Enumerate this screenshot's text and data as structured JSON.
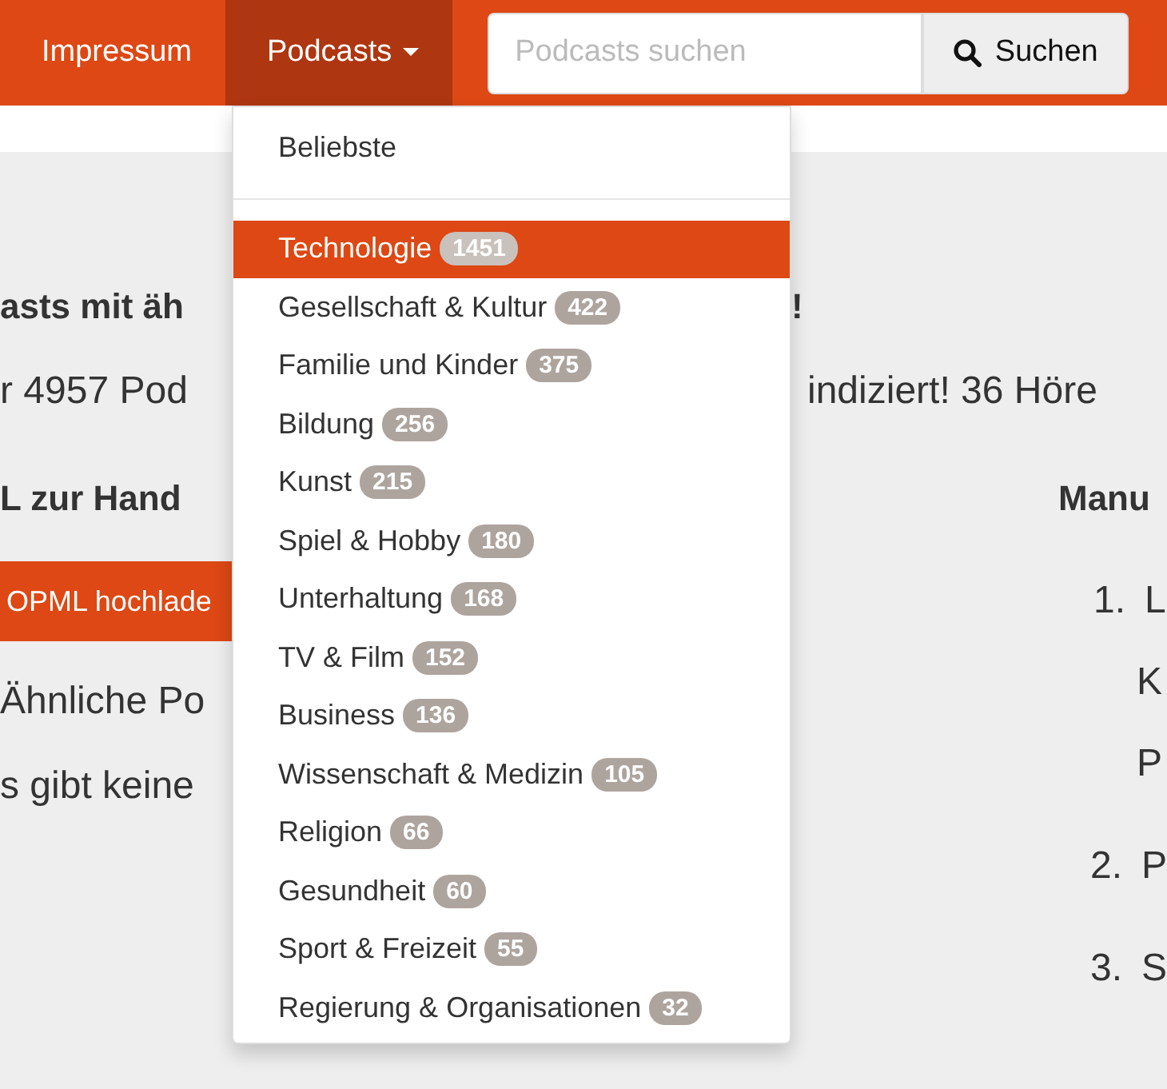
{
  "nav": {
    "items": [
      {
        "label": "Impressum",
        "selected": false,
        "kind": "link"
      },
      {
        "label": "Podcasts",
        "selected": true,
        "kind": "dropdown"
      }
    ],
    "search": {
      "placeholder": "Podcasts suchen",
      "button": "Suchen"
    }
  },
  "page": {
    "left": [
      {
        "kind": "heading",
        "text": "asts mit äh"
      },
      {
        "kind": "text",
        "text": "r 4957 Pod"
      },
      {
        "kind": "subheading",
        "text": "L zur Hand"
      },
      {
        "kind": "button",
        "text": "OPML hochlade"
      },
      {
        "kind": "text",
        "text": "Ähnliche Po"
      },
      {
        "kind": "text",
        "text": "s gibt keine"
      }
    ],
    "right": [
      {
        "kind": "heading",
        "text": "!"
      },
      {
        "kind": "text",
        "text": "indiziert! 36 Höre"
      },
      {
        "kind": "subheading",
        "text": "Manu"
      },
      {
        "kind": "list-item",
        "number": "1.",
        "text": "L"
      },
      {
        "kind": "note",
        "text": "K"
      },
      {
        "kind": "note",
        "text": "P"
      },
      {
        "kind": "list-item",
        "number": "2.",
        "text": "P"
      },
      {
        "kind": "list-item",
        "number": "3.",
        "text": "S"
      }
    ]
  },
  "dropdown": {
    "header": "Beliebste",
    "categories": [
      {
        "name": "Technologie",
        "count": "1451",
        "selected": true
      },
      {
        "name": "Gesellschaft & Kultur",
        "count": "422",
        "selected": false
      },
      {
        "name": "Familie und Kinder",
        "count": "375",
        "selected": false
      },
      {
        "name": "Bildung",
        "count": "256",
        "selected": false
      },
      {
        "name": "Kunst",
        "count": "215",
        "selected": false
      },
      {
        "name": "Spiel & Hobby",
        "count": "180",
        "selected": false
      },
      {
        "name": "Unterhaltung",
        "count": "168",
        "selected": false
      },
      {
        "name": "TV & Film",
        "count": "152",
        "selected": false
      },
      {
        "name": "Business",
        "count": "136",
        "selected": false
      },
      {
        "name": "Wissenschaft & Medizin",
        "count": "105",
        "selected": false
      },
      {
        "name": "Religion",
        "count": "66",
        "selected": false
      },
      {
        "name": "Gesundheit",
        "count": "60",
        "selected": false
      },
      {
        "name": "Sport & Freizeit",
        "count": "55",
        "selected": false
      },
      {
        "name": "Regierung & Organisationen",
        "count": "32",
        "selected": false
      }
    ]
  }
}
